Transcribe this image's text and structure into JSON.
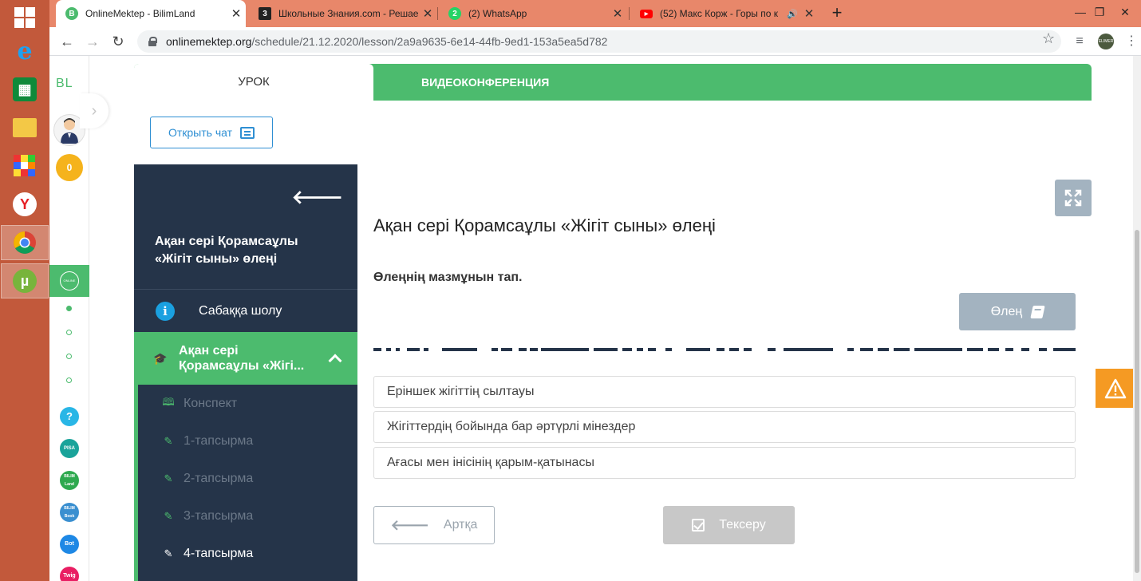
{
  "browser": {
    "tabs": [
      {
        "title": "OnlineMektep - BilimLand",
        "active": true
      },
      {
        "title": "Школьные Знания.com - Решаем",
        "active": false
      },
      {
        "title": "(2) WhatsApp",
        "active": false
      },
      {
        "title": "(52) Макс Корж - Горы по к",
        "active": false
      }
    ],
    "url_host": "onlinemektep.org",
    "url_path": "/schedule/21.12.2020/lesson/2a9a9635-6e14-44fb-9ed1-153a5ea5d782",
    "profile_initials": "ELIMER"
  },
  "rail": {
    "logo": "BL",
    "coins": "0",
    "active_badge": "ONLINE MEKTEP",
    "apps": [
      "?",
      "PISA",
      "BILIM Land",
      "BILIM Book",
      "Bot",
      "Twig"
    ]
  },
  "lesson_tabs": {
    "lesson": "УРОК",
    "video": "ВИДЕОКОНФЕРЕНЦИЯ"
  },
  "chat_button": "Открыть чат",
  "sidebar": {
    "title": "Ақан сері Қорамсаұлы «Жігіт сыны» өлеңі",
    "overview": "Сабаққа шолу",
    "active_section": "Ақан сері Қорамсаұлы «Жігі...",
    "items": [
      {
        "label": "Конспект",
        "icon": "book-icon"
      },
      {
        "label": "1-тапсырма",
        "icon": "edit-icon"
      },
      {
        "label": "2-тапсырма",
        "icon": "edit-icon"
      },
      {
        "label": "3-тапсырма",
        "icon": "edit-icon"
      },
      {
        "label": "4-тапсырма",
        "icon": "edit-icon"
      }
    ]
  },
  "content": {
    "heading": "Ақан сері Қорамсаұлы «Жігіт сыны» өлеңі",
    "question": "Өлеңнің мазмұнын тап.",
    "poem_button": "Өлең",
    "answers": [
      "Еріншек жігіттің сылтауы",
      "Жігіттердің бойында бар әртүрлі мінездер",
      "Ағасы мен інісінің қарым-қатынасы"
    ],
    "back_button": "Артқа",
    "check_button": "Тексеру"
  },
  "colors": {
    "accent_green": "#4cbb6e",
    "sidebar_navy": "#253449",
    "taskbar": "#c2593b",
    "tabstrip": "#e8876a"
  }
}
